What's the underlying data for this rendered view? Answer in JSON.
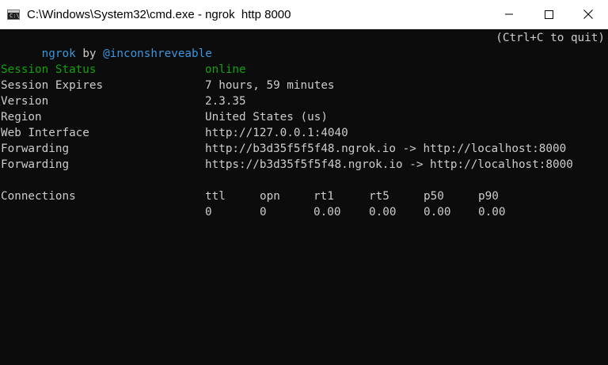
{
  "window": {
    "title": "C:\\Windows\\System32\\cmd.exe - ngrok  http 8000",
    "icon": "cmd-app-icon",
    "icon_glyph": "C:\\",
    "controls": [
      "minimize-icon",
      "maximize-icon",
      "close-icon"
    ]
  },
  "colors": {
    "console_bg": "#0c0c0c",
    "text": "#cccccc",
    "cyan": "#3a96dd",
    "green": "#13a10e"
  },
  "console": {
    "header_name": "ngrok",
    "header_by": "by",
    "header_author": "@inconshreveable",
    "header_quit_hint": "(Ctrl+C to quit)",
    "session_status_label": "Session Status",
    "session_status_value": "online",
    "session_expires_label": "Session Expires",
    "session_expires_value": "7 hours, 59 minutes",
    "version_label": "Version",
    "version_value": "2.3.35",
    "region_label": "Region",
    "region_value": "United States (us)",
    "web_interface_label": "Web Interface",
    "web_interface_value": "http://127.0.0.1:4040",
    "forwarding": [
      {
        "label": "Forwarding",
        "value": "http://b3d35f5f5f48.ngrok.io -> http://localhost:8000"
      },
      {
        "label": "Forwarding",
        "value": "https://b3d35f5f5f48.ngrok.io -> http://localhost:8000"
      }
    ],
    "connections_label": "Connections",
    "connections_headers": [
      "ttl",
      "opn",
      "rt1",
      "rt5",
      "p50",
      "p90"
    ],
    "connections_values": [
      "0",
      "0",
      "0.00",
      "0.00",
      "0.00",
      "0.00"
    ]
  }
}
